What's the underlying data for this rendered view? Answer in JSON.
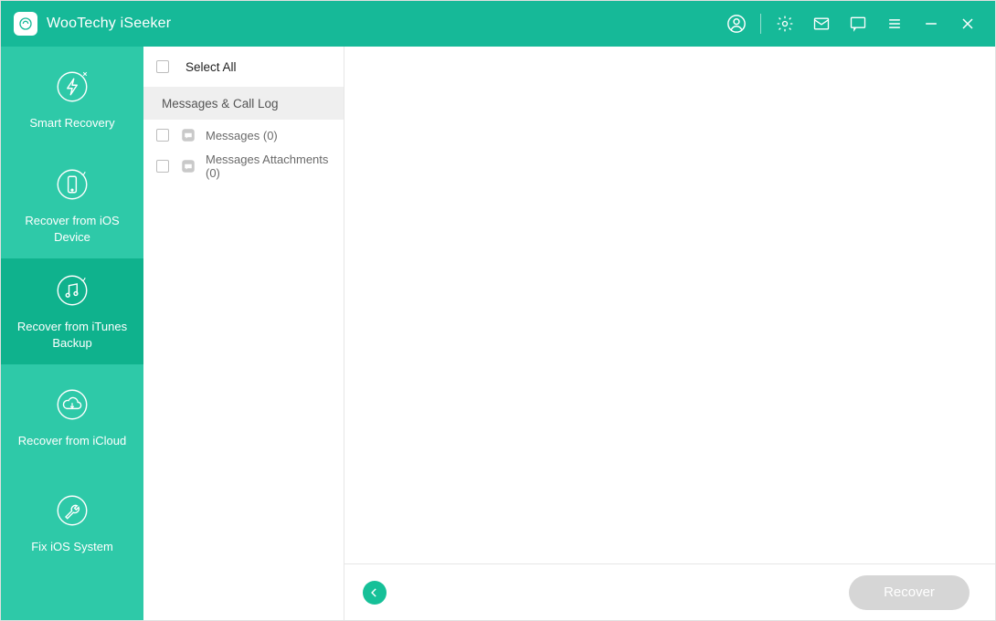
{
  "titlebar": {
    "app_name": "WooTechy iSeeker"
  },
  "sidebar": {
    "items": [
      {
        "id": "smart-recovery",
        "label": "Smart Recovery"
      },
      {
        "id": "recover-ios",
        "label": "Recover from iOS Device"
      },
      {
        "id": "recover-itunes",
        "label": "Recover from iTunes Backup"
      },
      {
        "id": "recover-icloud",
        "label": "Recover from iCloud"
      },
      {
        "id": "fix-ios",
        "label": "Fix iOS System"
      }
    ],
    "active_id": "recover-itunes"
  },
  "categories": {
    "select_all_label": "Select All",
    "groups": [
      {
        "header": "Messages & Call Log",
        "items": [
          {
            "id": "messages",
            "label": "Messages (0)",
            "icon": "message-bubble-icon"
          },
          {
            "id": "messages-attachments",
            "label": "Messages Attachments (0)",
            "icon": "message-bubble-icon"
          }
        ]
      }
    ]
  },
  "footer": {
    "recover_label": "Recover"
  }
}
